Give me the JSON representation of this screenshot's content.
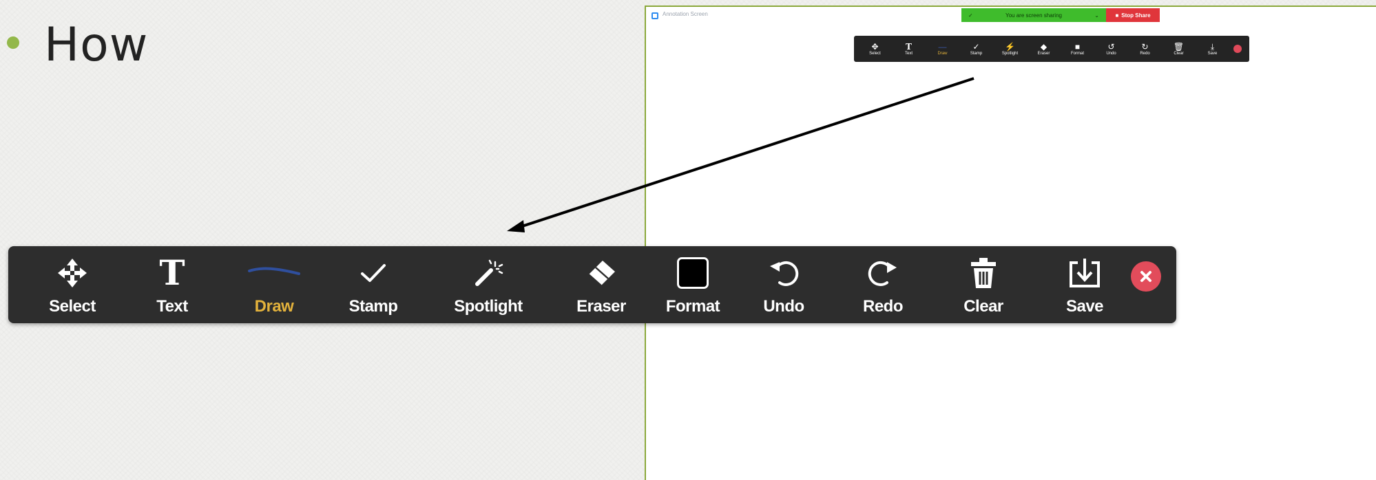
{
  "slide": {
    "heading": "How",
    "accent": "#93b84a"
  },
  "screenshot": {
    "app_title": "Annotation Screen",
    "share_status": "You are screen sharing",
    "stop_share_label": "Stop Share",
    "mini_tools": [
      "Select",
      "Text",
      "Draw",
      "Stamp",
      "Spotlight",
      "Eraser",
      "Format",
      "Undo",
      "Redo",
      "Clear",
      "Save"
    ]
  },
  "toolbar": {
    "tools": [
      {
        "label": "Select",
        "icon": "move-arrows-icon"
      },
      {
        "label": "Text",
        "icon": "text-t-icon"
      },
      {
        "label": "Draw",
        "icon": "draw-line-icon",
        "active": true
      },
      {
        "label": "Stamp",
        "icon": "checkmark-icon"
      },
      {
        "label": "Spotlight",
        "icon": "magic-wand-icon"
      },
      {
        "label": "Eraser",
        "icon": "eraser-icon"
      },
      {
        "label": "Format",
        "icon": "color-swatch-icon"
      },
      {
        "label": "Undo",
        "icon": "undo-icon"
      },
      {
        "label": "Redo",
        "icon": "redo-icon"
      },
      {
        "label": "Clear",
        "icon": "trash-icon"
      },
      {
        "label": "Save",
        "icon": "download-save-icon"
      }
    ],
    "close_icon": "close-icon",
    "colors": {
      "background": "#2d2d2d",
      "active_label": "#e3b23c",
      "close": "#e24c5b"
    }
  }
}
